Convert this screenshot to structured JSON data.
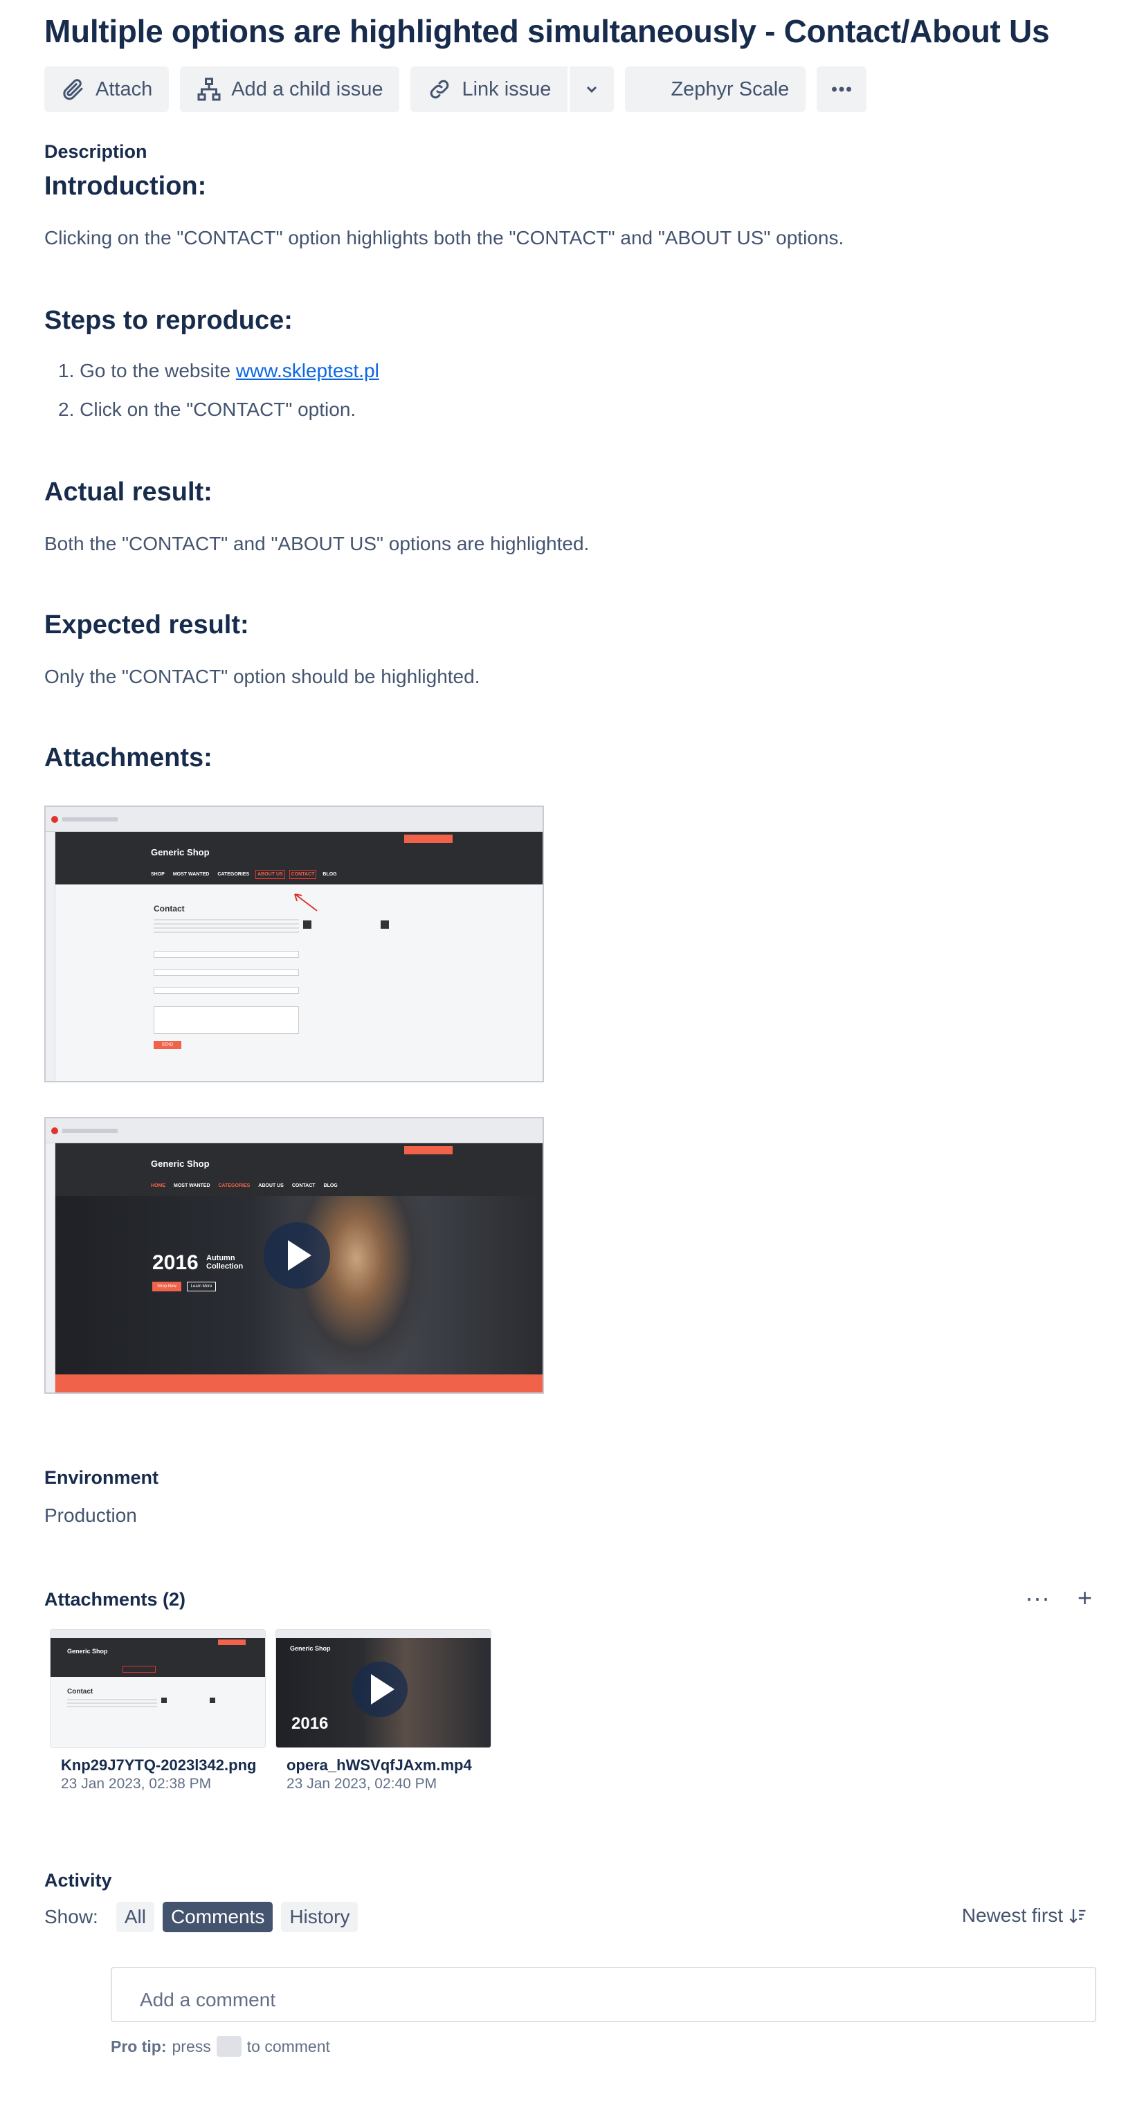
{
  "issue": {
    "title": "Multiple options are highlighted simultaneously - Contact/About Us"
  },
  "toolbar": {
    "attach": "Attach",
    "add_child": "Add a child issue",
    "link_issue": "Link issue",
    "zephyr": "Zephyr Scale"
  },
  "description": {
    "label": "Description",
    "intro_heading": "Introduction:",
    "intro_text": "Clicking on the \"CONTACT\" option highlights both the \"CONTACT\" and \"ABOUT US\" options.",
    "steps_heading": "Steps to reproduce:",
    "steps": [
      {
        "num": "1.",
        "text": "Go to the website ",
        "link": "www.skleptest.pl"
      },
      {
        "num": "2.",
        "text": "Click on the \"CONTACT\" option."
      }
    ],
    "actual_heading": "Actual result:",
    "actual_text": "Both the \"CONTACT\" and \"ABOUT US\" options are highlighted.",
    "expected_heading": "Expected result:",
    "expected_text": "Only the \"CONTACT\" option should be highlighted.",
    "attachments_heading": "Attachments:"
  },
  "screenshot1": {
    "site_title": "Generic Shop",
    "nav": [
      "SHOP",
      "MOST WANTED",
      "CATEGORIES",
      "ABOUT US",
      "CONTACT",
      "BLOG"
    ],
    "page_heading": "Contact",
    "send": "SEND"
  },
  "screenshot2": {
    "site_title": "Generic Shop",
    "nav": [
      "HOME",
      "MOST WANTED",
      "CATEGORIES",
      "ABOUT US",
      "CONTACT",
      "BLOG"
    ],
    "hero_year": "2016",
    "hero_text": "Autumn Collection",
    "shop_now": "Shop Now",
    "learn_more": "Learn More"
  },
  "environment": {
    "label": "Environment",
    "value": "Production"
  },
  "attachments": {
    "heading": "Attachments (2)",
    "files": [
      {
        "name": "Knp29J7YTQ-2023l342.png",
        "date": "23 Jan 2023, 02:38 PM"
      },
      {
        "name": "opera_hWSVqfJAxm.mp4",
        "date": "23 Jan 2023, 02:40 PM"
      }
    ]
  },
  "activity": {
    "heading": "Activity",
    "show_label": "Show:",
    "filters": [
      "All",
      "Comments",
      "History"
    ],
    "active_filter": "Comments",
    "sort": "Newest first",
    "comment_placeholder": "Add a comment",
    "protip_label": "Pro tip:",
    "protip_pre": "press",
    "protip_post": "to comment"
  },
  "colors": {
    "accent_red": "#f0624a",
    "link": "#0c66e4",
    "text": "#172b4d"
  }
}
